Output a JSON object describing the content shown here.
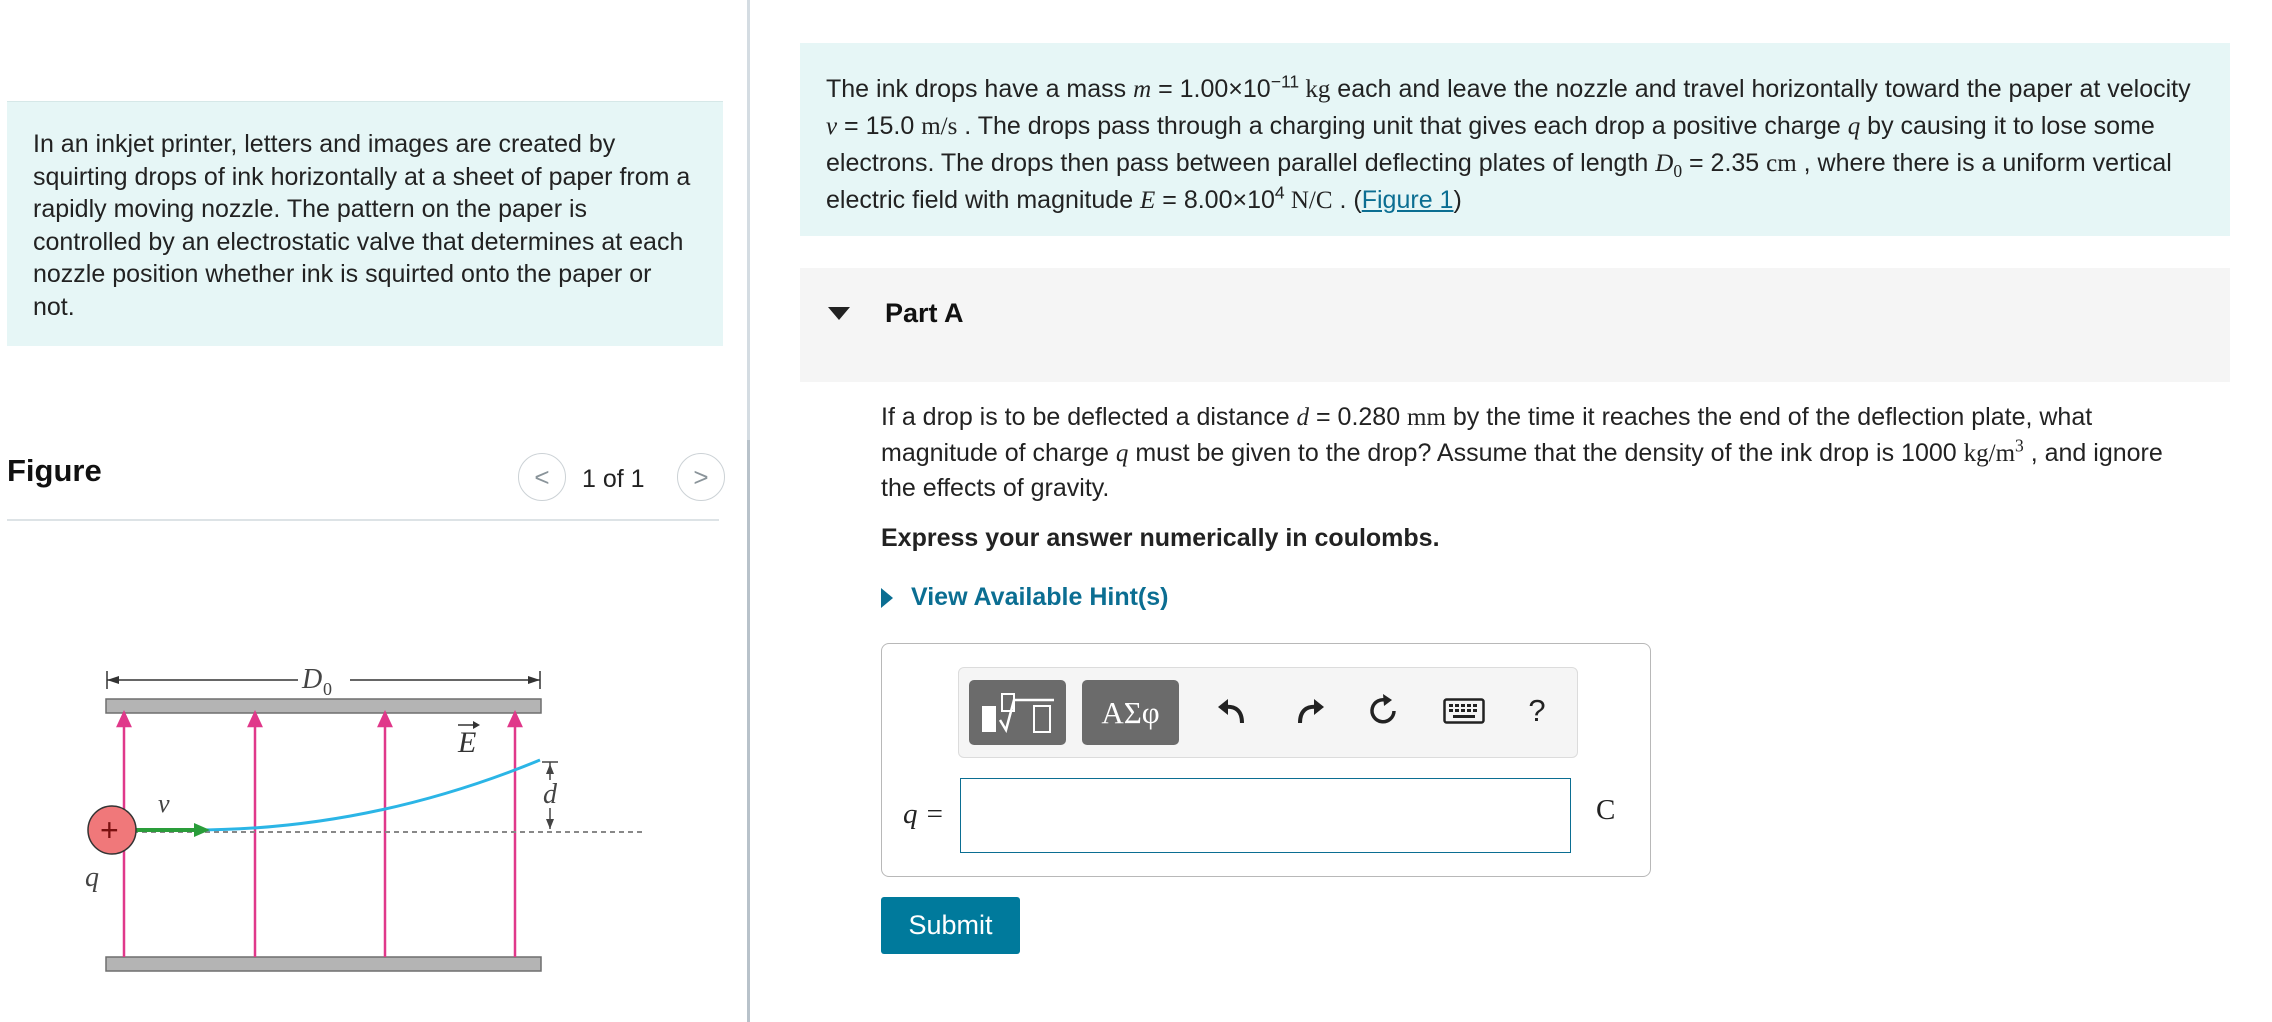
{
  "intro": {
    "text": "In an inkjet printer, letters and images are created by squirting drops of ink horizontally at a sheet of paper from a rapidly moving nozzle. The pattern on the paper is controlled by an electrostatic valve that determines at each nozzle position whether ink is squirted onto the paper or not."
  },
  "figure_panel": {
    "title": "Figure",
    "count": "1 of 1",
    "prev_glyph": "<",
    "next_glyph": ">",
    "diagram_labels": {
      "length": "D",
      "length_sub": "0",
      "field": "E",
      "velocity": "v",
      "deflection": "d",
      "charge": "q",
      "plus": "+"
    }
  },
  "problem": {
    "p1": "The ink drops have a mass ",
    "m_sym": "m",
    "m_val_a": " = 1.00×10",
    "m_exp": "−11",
    "m_unit": " kg",
    "p2": " each and leave the nozzle and travel horizontally toward the paper at velocity ",
    "v_sym": "v",
    "v_val": " = 15.0 ",
    "v_unit": "m/s",
    "p3": " . The drops pass through a charging unit that gives each drop a positive charge ",
    "q_sym": "q",
    "p4": " by causing it to lose some electrons. The drops then pass between parallel deflecting plates of length ",
    "D_sym": "D",
    "D_sub": "0",
    "D_val": " = 2.35 ",
    "D_unit": "cm",
    "p5": " , where there is a uniform vertical electric field with magnitude ",
    "E_sym": "E",
    "E_val": " = 8.00×10",
    "E_exp": "4",
    "E_unit": " N/C",
    "p6": " . (",
    "link": "Figure 1",
    "p7": ")"
  },
  "part_a": {
    "title": "Part A",
    "q1": "If a drop is to be deflected a distance ",
    "d_sym": "d",
    "d_val": " = 0.280 ",
    "d_unit": "mm",
    "q2": " by the time it reaches the end of the deflection plate, what magnitude of charge ",
    "q_sym": "q",
    "q3": " must be given to the drop? Assume that the density of the ink drop is 1000 ",
    "rho_unit": "kg/m",
    "rho_exp": "3",
    "q4": " , and ignore the effects of gravity.",
    "instruction": "Express your answer numerically in coulombs.",
    "hint": "View Available Hint(s)",
    "toolbar": {
      "greek": "ΑΣφ",
      "help": "?"
    },
    "answer_label": "q =",
    "answer_value": "",
    "unit": "C",
    "submit": "Submit"
  },
  "colors": {
    "panel_bg": "#e6f6f6",
    "link": "#0b6e92",
    "submit": "#007a9c",
    "field_lines": "#e0388a",
    "trajectory": "#2bb5e6",
    "velocity_arrow": "#2a9d3a",
    "charge_fill": "#f0787a"
  }
}
